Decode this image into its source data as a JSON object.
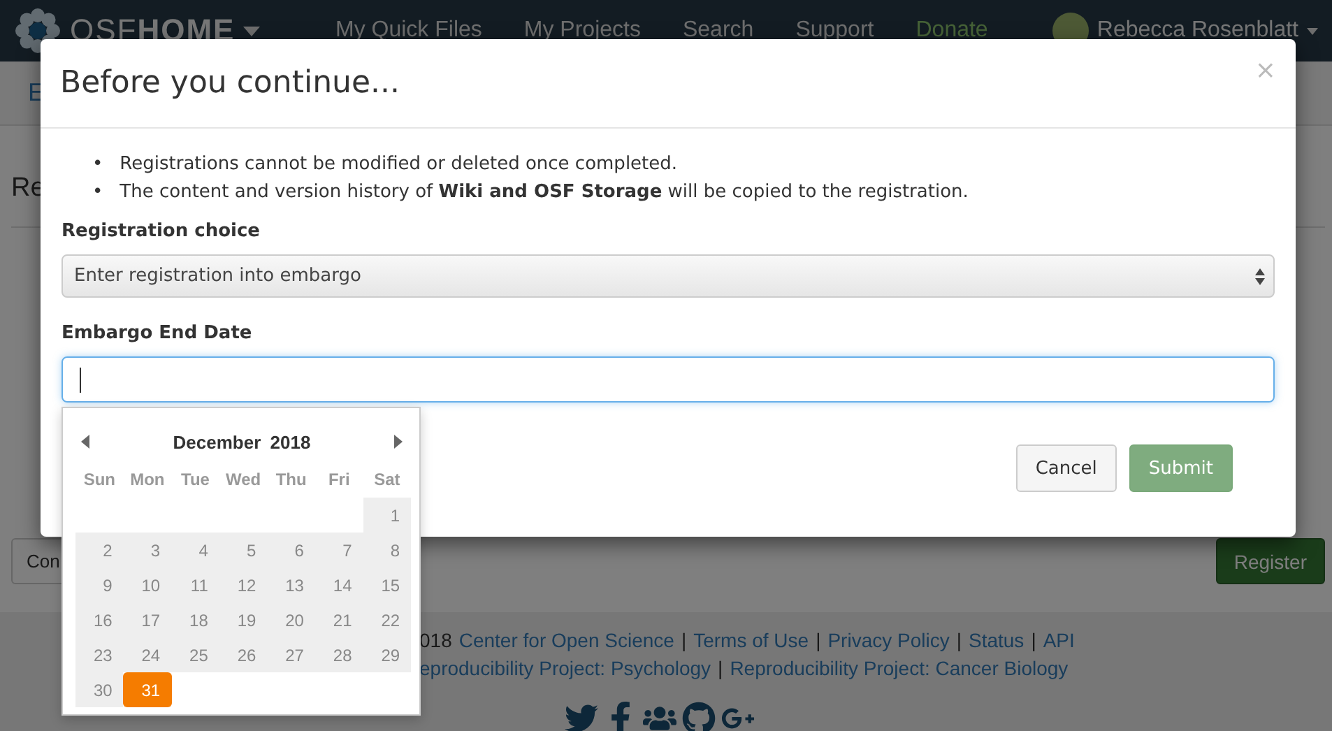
{
  "navbar": {
    "brand_light": "OSF",
    "brand_bold": "HOME",
    "links": [
      {
        "label": "My Quick Files",
        "kind": "plain"
      },
      {
        "label": "My Projects",
        "kind": "plain"
      },
      {
        "label": "Search",
        "kind": "plain"
      },
      {
        "label": "Support",
        "kind": "plain"
      },
      {
        "label": "Donate",
        "kind": "donate"
      }
    ],
    "user": "Rebecca Rosenblatt"
  },
  "page": {
    "breadcrumb": "E",
    "heading": "Re",
    "left_button": "Con",
    "register_button": "Register"
  },
  "footer": {
    "lines": [
      [
        {
          "text": "018",
          "kind": "plain"
        },
        {
          "text": "Center for Open Science",
          "kind": "link"
        },
        {
          "text": "|",
          "kind": "sep"
        },
        {
          "text": "Terms of Use",
          "kind": "link"
        },
        {
          "text": "|",
          "kind": "sep"
        },
        {
          "text": "Privacy Policy",
          "kind": "link"
        },
        {
          "text": "|",
          "kind": "sep"
        },
        {
          "text": "Status",
          "kind": "link"
        },
        {
          "text": "|",
          "kind": "sep"
        },
        {
          "text": "API",
          "kind": "link"
        }
      ],
      [
        {
          "text": "eproducibility Project: Psychology",
          "kind": "link"
        },
        {
          "text": "|",
          "kind": "sep"
        },
        {
          "text": "Reproducibility Project: Cancer Biology",
          "kind": "link"
        }
      ]
    ]
  },
  "modal": {
    "title": "Before you continue...",
    "close": "×",
    "bullet": "•",
    "notes": [
      "Registrations cannot be modified or deleted once completed.",
      "The content and version history of **Wiki and OSF Storage** will be copied to the registration."
    ],
    "choice_label": "Registration choice",
    "choice_value": "Enter registration into embargo",
    "date_label": "Embargo End Date",
    "buttons": [
      {
        "label": "Cancel",
        "kind": "default"
      },
      {
        "label": "Submit",
        "kind": "primary"
      }
    ]
  },
  "datepicker": {
    "month": "December",
    "year": "2018",
    "weekdays": [
      "Sun",
      "Mon",
      "Tue",
      "Wed",
      "Thu",
      "Fri",
      "Sat"
    ],
    "weeks": [
      {
        "kind": "leading",
        "days": [
          {
            "day": "1",
            "disabled": true,
            "selected": false
          }
        ]
      },
      {
        "kind": "full",
        "days": [
          {
            "day": "2",
            "disabled": true,
            "selected": false
          },
          {
            "day": "3",
            "disabled": true,
            "selected": false
          },
          {
            "day": "4",
            "disabled": true,
            "selected": false
          },
          {
            "day": "5",
            "disabled": true,
            "selected": false
          },
          {
            "day": "6",
            "disabled": true,
            "selected": false
          },
          {
            "day": "7",
            "disabled": true,
            "selected": false
          },
          {
            "day": "8",
            "disabled": true,
            "selected": false
          }
        ]
      },
      {
        "kind": "full",
        "days": [
          {
            "day": "9",
            "disabled": true,
            "selected": false
          },
          {
            "day": "10",
            "disabled": true,
            "selected": false
          },
          {
            "day": "11",
            "disabled": true,
            "selected": false
          },
          {
            "day": "12",
            "disabled": true,
            "selected": false
          },
          {
            "day": "13",
            "disabled": true,
            "selected": false
          },
          {
            "day": "14",
            "disabled": true,
            "selected": false
          },
          {
            "day": "15",
            "disabled": true,
            "selected": false
          }
        ]
      },
      {
        "kind": "full",
        "days": [
          {
            "day": "16",
            "disabled": true,
            "selected": false
          },
          {
            "day": "17",
            "disabled": true,
            "selected": false
          },
          {
            "day": "18",
            "disabled": true,
            "selected": false
          },
          {
            "day": "19",
            "disabled": true,
            "selected": false
          },
          {
            "day": "20",
            "disabled": true,
            "selected": false
          },
          {
            "day": "21",
            "disabled": true,
            "selected": false
          },
          {
            "day": "22",
            "disabled": true,
            "selected": false
          }
        ]
      },
      {
        "kind": "full",
        "days": [
          {
            "day": "23",
            "disabled": true,
            "selected": false
          },
          {
            "day": "24",
            "disabled": true,
            "selected": false
          },
          {
            "day": "25",
            "disabled": true,
            "selected": false
          },
          {
            "day": "26",
            "disabled": true,
            "selected": false
          },
          {
            "day": "27",
            "disabled": true,
            "selected": false
          },
          {
            "day": "28",
            "disabled": true,
            "selected": false
          },
          {
            "day": "29",
            "disabled": true,
            "selected": false
          }
        ]
      },
      {
        "kind": "trailing",
        "days": [
          {
            "day": "30",
            "disabled": true,
            "selected": false
          },
          {
            "day": "31",
            "disabled": false,
            "selected": true
          }
        ]
      }
    ]
  }
}
